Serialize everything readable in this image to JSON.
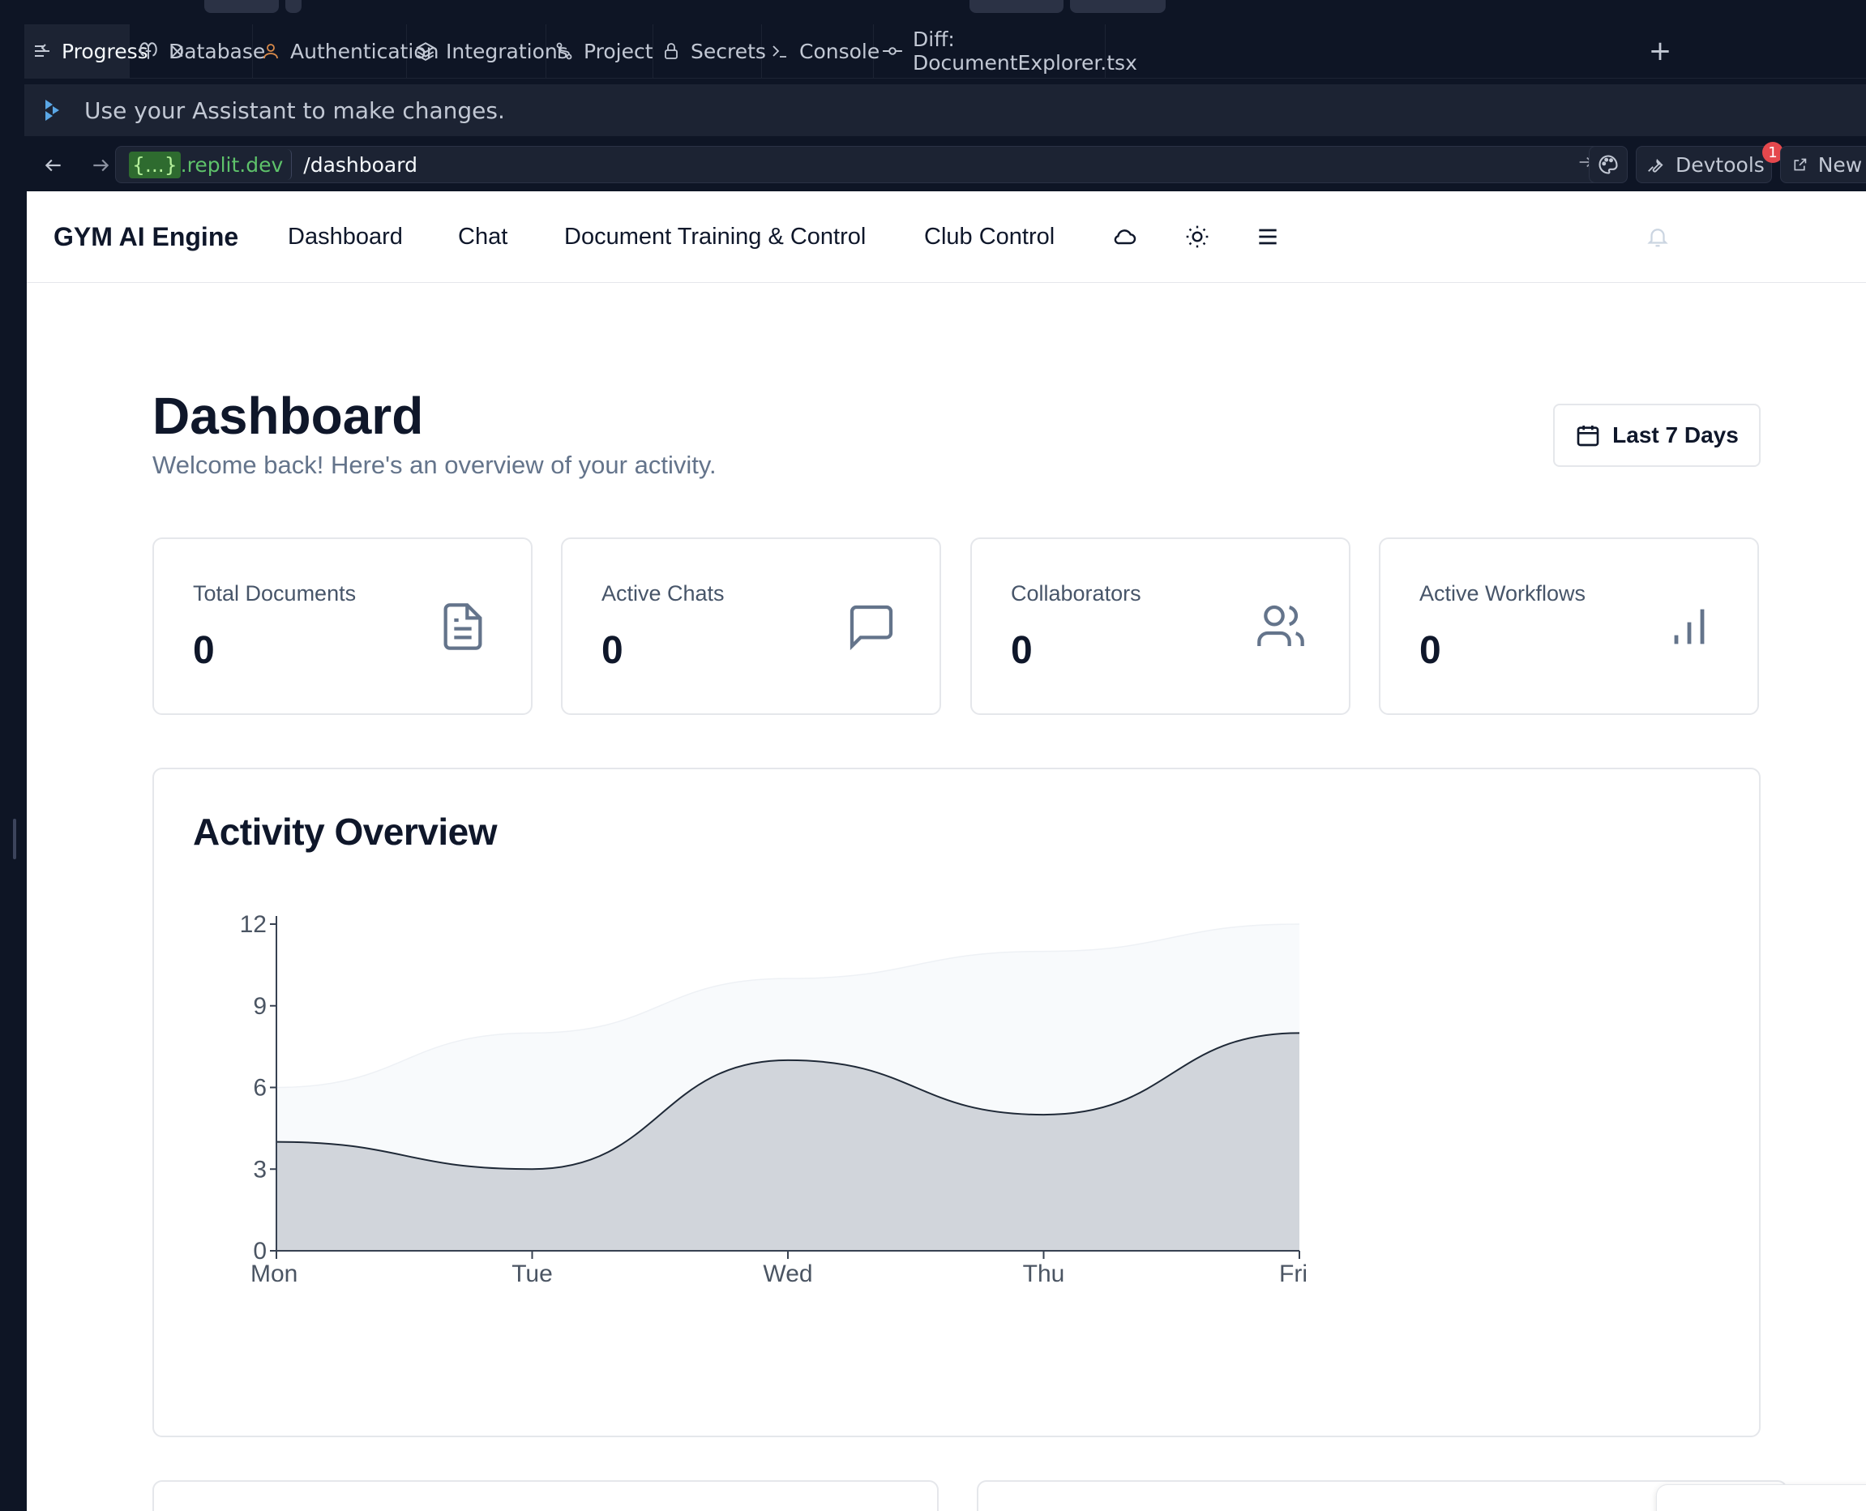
{
  "ide": {
    "tabs": [
      {
        "label": "Progress",
        "icon": "progress-icon",
        "active": true
      },
      {
        "label": "Database",
        "icon": "database-icon"
      },
      {
        "label": "Authentication",
        "icon": "user-icon"
      },
      {
        "label": "Integrations",
        "icon": "layers-icon"
      },
      {
        "label": "Project",
        "icon": "git-branch-icon"
      },
      {
        "label": "Secrets",
        "icon": "lock-icon"
      },
      {
        "label": "Console",
        "icon": "terminal-icon"
      },
      {
        "label": "Diff: DocumentExplorer.tsx",
        "icon": "git-commit-icon"
      }
    ],
    "close_glyph": "×",
    "add_tab_glyph": "+",
    "assistant_hint": "Use your Assistant to make changes.",
    "url": {
      "domain_braces": "{...}",
      "domain_rest": ".replit.dev",
      "path": "/dashboard"
    },
    "devtools_label": "Devtools",
    "devtools_badge": "1",
    "new_tab_label": "New t",
    "colors": {
      "ide_bg": "#0e1525",
      "ide_panel": "#1c2333",
      "domain_green": "#5ec26a",
      "badge_red": "#e5484d"
    }
  },
  "app": {
    "brand": "GYM AI Engine",
    "nav": {
      "dashboard": "Dashboard",
      "chat": "Chat",
      "docs": "Document Training & Control",
      "club": "Club Control"
    },
    "nav_icons": [
      "cloud-icon",
      "sun-icon",
      "menu-icon",
      "bell-icon"
    ],
    "page": {
      "title": "Dashboard",
      "subtitle": "Welcome back! Here's an overview of your activity.",
      "range_label": "Last 7 Days"
    },
    "stats": [
      {
        "label": "Total Documents",
        "value": "0",
        "icon": "file-text-icon"
      },
      {
        "label": "Active Chats",
        "value": "0",
        "icon": "message-square-icon"
      },
      {
        "label": "Collaborators",
        "value": "0",
        "icon": "users-icon"
      },
      {
        "label": "Active Workflows",
        "value": "0",
        "icon": "bar-chart-icon"
      }
    ],
    "chart_title": "Activity Overview"
  },
  "chart_data": {
    "type": "area",
    "title": "Activity Overview",
    "categories": [
      "Mon",
      "Tue",
      "Wed",
      "Thu",
      "Fri"
    ],
    "series": [
      {
        "values": [
          6,
          8,
          10,
          11,
          12
        ],
        "color": "#f8fafc"
      },
      {
        "values": [
          4,
          3,
          7,
          5,
          8
        ],
        "color": "#d1d5db"
      }
    ],
    "ylim": [
      0,
      12
    ],
    "yticks": [
      0,
      3,
      6,
      9,
      12
    ],
    "grid": false,
    "legend": "none"
  }
}
